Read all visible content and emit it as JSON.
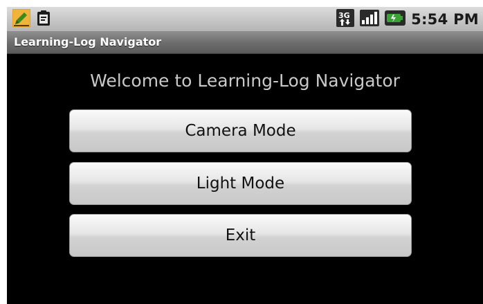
{
  "status_bar": {
    "icons_left": [
      "edit-pencil-icon",
      "clipboard-icon"
    ],
    "icons_right": [
      "3g-data-icon",
      "signal-strength-icon",
      "battery-icon"
    ],
    "network_label": "3G",
    "time": "5:54 PM"
  },
  "title_bar": {
    "title": "Learning-Log Navigator"
  },
  "main": {
    "welcome": "Welcome to Learning-Log Navigator",
    "buttons": [
      {
        "label": "Camera Mode"
      },
      {
        "label": "Light Mode"
      },
      {
        "label": "Exit"
      }
    ]
  },
  "colors": {
    "background": "#000000",
    "status_bar": "#c8c8c8",
    "title_bar": "#6e6e6e",
    "welcome_text": "#c9c9c9",
    "button_face": "#e0e0e0",
    "battery_accent": "#3aa236",
    "notification_accent": "#e8a020"
  }
}
